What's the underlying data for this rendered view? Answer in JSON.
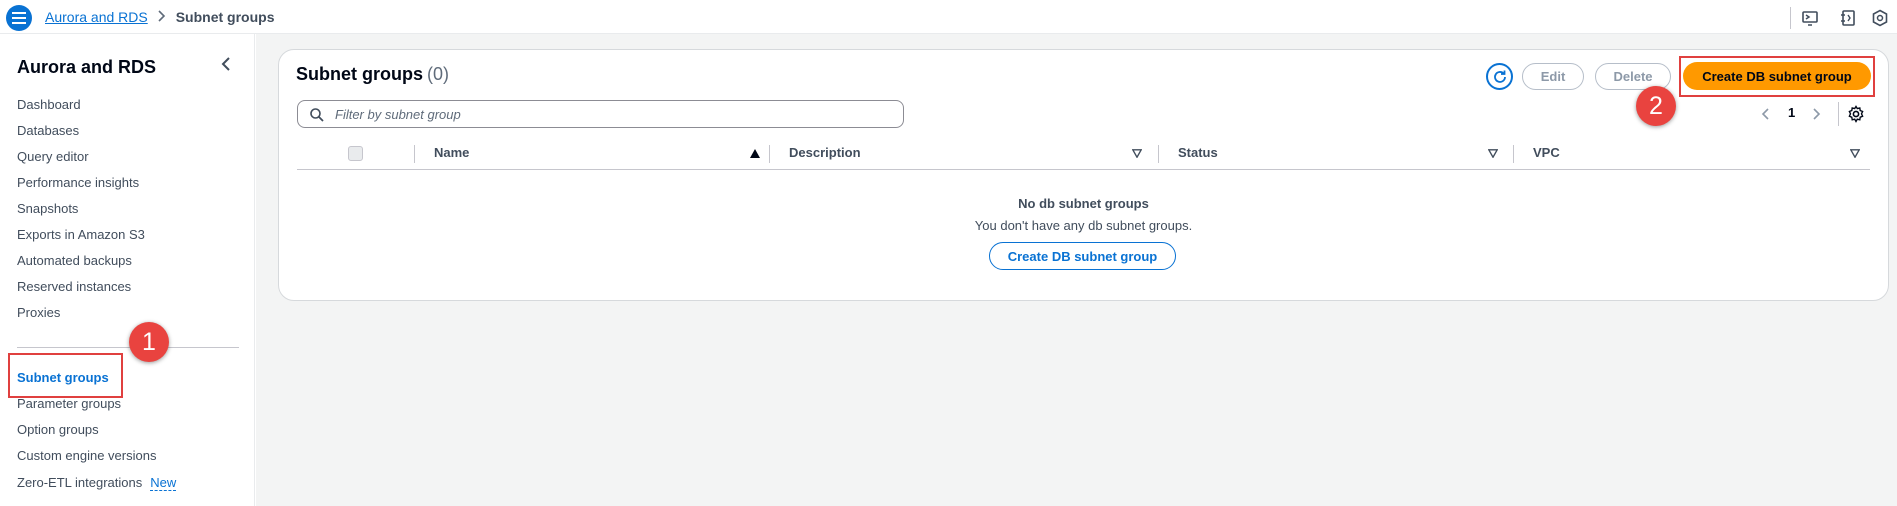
{
  "breadcrumb": {
    "root": "Aurora and RDS",
    "current": "Subnet groups"
  },
  "sidebar": {
    "title": "Aurora and RDS",
    "items": [
      {
        "label": "Dashboard"
      },
      {
        "label": "Databases"
      },
      {
        "label": "Query editor"
      },
      {
        "label": "Performance insights"
      },
      {
        "label": "Snapshots"
      },
      {
        "label": "Exports in Amazon S3"
      },
      {
        "label": "Automated backups"
      },
      {
        "label": "Reserved instances"
      },
      {
        "label": "Proxies"
      },
      {
        "label": "Subnet groups",
        "active": true
      },
      {
        "label": "Parameter groups"
      },
      {
        "label": "Option groups"
      },
      {
        "label": "Custom engine versions"
      },
      {
        "label": "Zero-ETL integrations",
        "badge": "New"
      }
    ]
  },
  "panel": {
    "title": "Subnet groups",
    "count": "(0)",
    "edit_label": "Edit",
    "delete_label": "Delete",
    "create_label": "Create DB subnet group",
    "filter_placeholder": "Filter by subnet group",
    "page_number": "1",
    "columns": [
      {
        "label": "Name"
      },
      {
        "label": "Description"
      },
      {
        "label": "Status"
      },
      {
        "label": "VPC"
      }
    ],
    "empty_title": "No db subnet groups",
    "empty_desc": "You don't have any db subnet groups.",
    "empty_create_label": "Create DB subnet group"
  },
  "annotations": {
    "callout_1": "1",
    "callout_2": "2"
  },
  "icons": {
    "menu": "hamburger-icon",
    "refresh": "refresh-icon",
    "search": "search-icon",
    "settings": "gear-icon",
    "close": "chevron-left-icon"
  },
  "colors": {
    "link": "#0972d3",
    "primary": "#ff9900",
    "callout": "#e9433f"
  }
}
